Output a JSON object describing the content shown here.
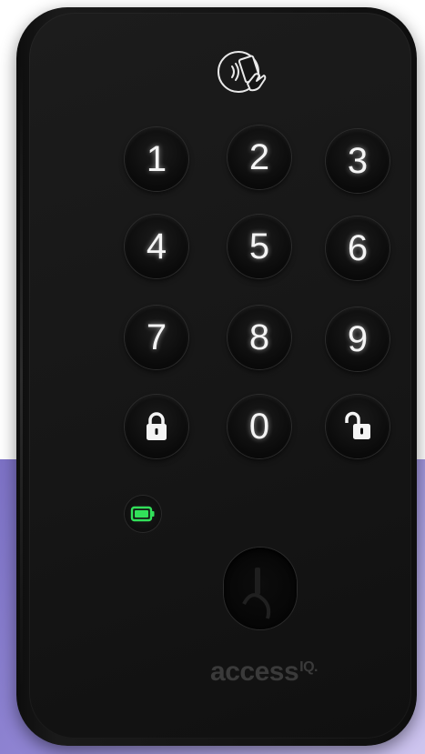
{
  "keypad": {
    "keys": [
      "1",
      "2",
      "3",
      "4",
      "5",
      "6",
      "7",
      "8",
      "9",
      "0"
    ]
  },
  "brand": {
    "name": "access",
    "suffix": "IQ."
  },
  "icons": {
    "nfc": "nfc-contactless-icon",
    "lock": "lock-icon",
    "unlock": "unlock-icon",
    "battery": "battery-icon",
    "keyhole": "keyhole-icon"
  },
  "colors": {
    "battery_green": "#32e05a",
    "key_glow": "#f4f4f4",
    "background_purple": "#8f84d2"
  }
}
